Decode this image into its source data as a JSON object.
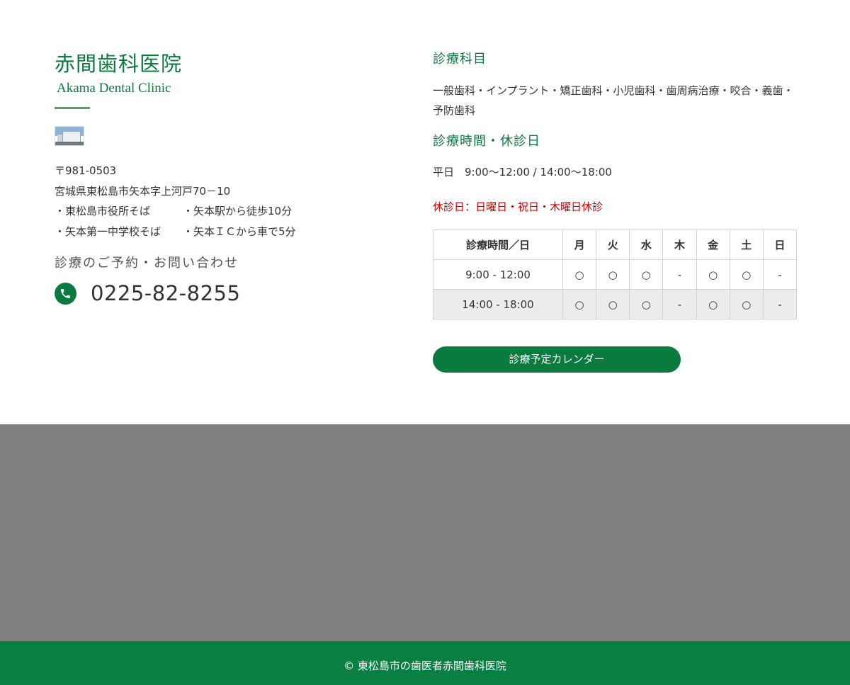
{
  "clinic": {
    "name": "赤間歯科医院",
    "name_en": "Akama Dental Clinic",
    "postal": "〒981-0503",
    "address": "宮城県東松島市矢本字上河戸70－10",
    "access": [
      [
        "・東松島市役所そば",
        "・矢本駅から徒歩10分"
      ],
      [
        "・矢本第一中学校そば",
        "・矢本ＩＣから車で5分"
      ]
    ],
    "contact_title": "診療のご予約・お問い合わせ",
    "phone": "0225-82-8255",
    "phone_icon": "phone-icon"
  },
  "departments": {
    "title": "診療科目",
    "text": "一般歯科・インプラント・矯正歯科・小児歯科・歯周病治療・咬合・義歯・予防歯科"
  },
  "hours": {
    "title": "診療時間・休診日",
    "weekday": "平日　9:00～12:00 / 14:00～18:00",
    "closed": "休診日：日曜日・祝日・木曜日休診"
  },
  "schedule": {
    "header": [
      "診療時間／日",
      "月",
      "火",
      "水",
      "木",
      "金",
      "土",
      "日"
    ],
    "rows": [
      [
        "9:00 - 12:00",
        "○",
        "○",
        "○",
        "-",
        "○",
        "○",
        "-"
      ],
      [
        "14:00 - 18:00",
        "○",
        "○",
        "○",
        "-",
        "○",
        "○",
        "-"
      ]
    ]
  },
  "calendar_button": "診療予定カレンダー",
  "footer": "© 東松島市の歯医者赤間歯科医院",
  "colors": {
    "brand_green": "#0a7a3f",
    "footer_green": "#0a7f42",
    "closed_red": "#cc0000",
    "band_gray": "#808080"
  }
}
